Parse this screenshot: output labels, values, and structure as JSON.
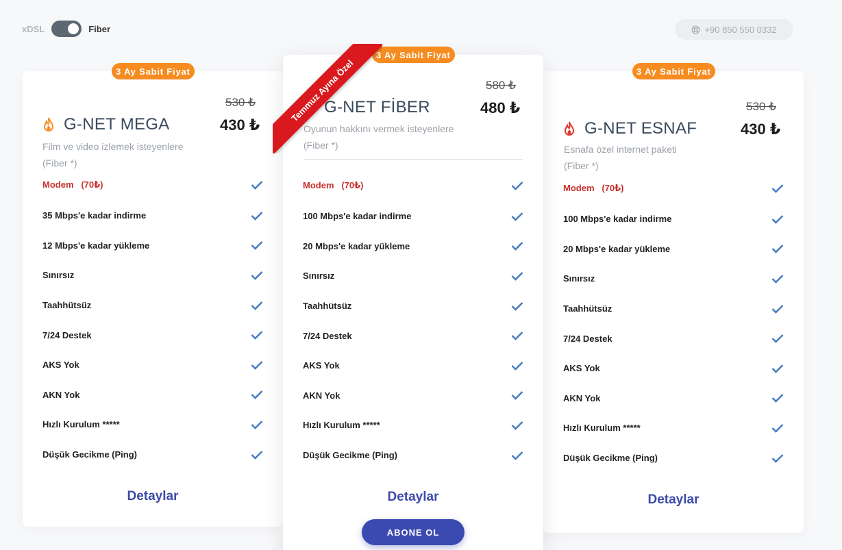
{
  "toggle": {
    "left_label": "xDSL",
    "right_label": "Fiber",
    "selected": "Fiber"
  },
  "phone": {
    "number": "+90 850 550 0332",
    "icon": "lifebuoy-icon"
  },
  "ribbon": {
    "text": "Temmuz Ayına Özel"
  },
  "colors": {
    "badge": "#f68b1f",
    "ribbon": "#d9191e",
    "accent": "#3b4ab1",
    "check": "#4a7fc1",
    "modem": "#c9302c"
  },
  "plans": [
    {
      "badge": "3 Ay Sabit Fiyat",
      "name": "G-NET MEGA",
      "icon": "flame-orange-icon",
      "old_price": "530 ₺",
      "price": "430 ₺",
      "description": "Film ve video izlemek isteyenlere",
      "sub_description": "(Fiber *)",
      "features": [
        "Modem   (70₺)",
        "35 Mbps'e kadar indirme",
        "12 Mbps'e kadar yükleme",
        "Sınırsız",
        "Taahhütsüz",
        "7/24 Destek",
        "AKS Yok",
        "AKN Yok",
        "Hızlı Kurulum *****",
        "Düşük Gecikme (Ping)"
      ],
      "details_label": "Detaylar"
    },
    {
      "badge": "3 Ay Sabit Fiyat",
      "name": "G-NET FİBER",
      "icon": "leaf-green-icon",
      "old_price": "580 ₺",
      "price": "480 ₺",
      "description": "Oyunun hakkını vermek isteyenlere",
      "sub_description": "(Fiber *)",
      "features": [
        "Modem   (70₺)",
        "100 Mbps'e kadar indirme",
        "20 Mbps'e kadar yükleme",
        "Sınırsız",
        "Taahhütsüz",
        "7/24 Destek",
        "AKS Yok",
        "AKN Yok",
        "Hızlı Kurulum *****",
        "Düşük Gecikme (Ping)"
      ],
      "details_label": "Detaylar",
      "subscribe_label": "ABONE OL"
    },
    {
      "badge": "3 Ay Sabit Fiyat",
      "name": "G-NET ESNAF",
      "icon": "flame-red-icon",
      "old_price": "530 ₺",
      "price": "430 ₺",
      "description": "Esnafa özel internet paketi",
      "sub_description": "(Fiber *)",
      "features": [
        "Modem   (70₺)",
        "100 Mbps'e kadar indirme",
        "20 Mbps'e kadar yükleme",
        "Sınırsız",
        "Taahhütsüz",
        "7/24 Destek",
        "AKS Yok",
        "AKN Yok",
        "Hızlı Kurulum *****",
        "Düşük Gecikme (Ping)"
      ],
      "details_label": "Detaylar"
    }
  ]
}
